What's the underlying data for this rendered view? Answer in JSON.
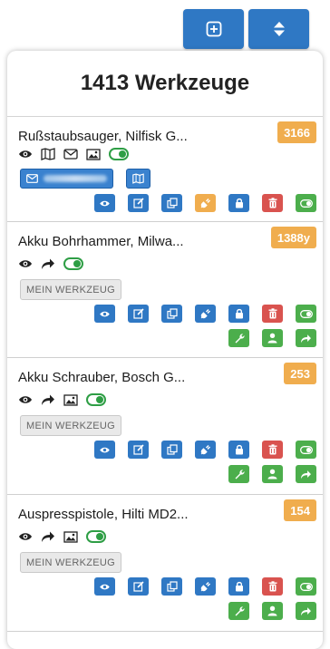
{
  "toolbar": {
    "add_label": "⊞",
    "sort_label": "⇕"
  },
  "header": {
    "title": "1413 Werkzeuge"
  },
  "items": [
    {
      "name": "Rußstaubsauger, Nilfisk G...",
      "badge": "3166",
      "chips": true
    },
    {
      "name": "Akku Bohrhammer, Milwa...",
      "badge": "1388y",
      "tag": "MEIN WERKZEUG"
    },
    {
      "name": "Akku Schrauber, Bosch G...",
      "badge": "253",
      "tag": "MEIN WERKZEUG"
    },
    {
      "name": "Auspresspistole, Hilti MD2...",
      "badge": "154",
      "tag": "MEIN WERKZEUG"
    }
  ],
  "colors": {
    "primary": "#2f78c4",
    "warning": "#f0ad4e",
    "danger": "#d9534f",
    "success": "#4cae4c",
    "toggle": "#2e9e45"
  }
}
